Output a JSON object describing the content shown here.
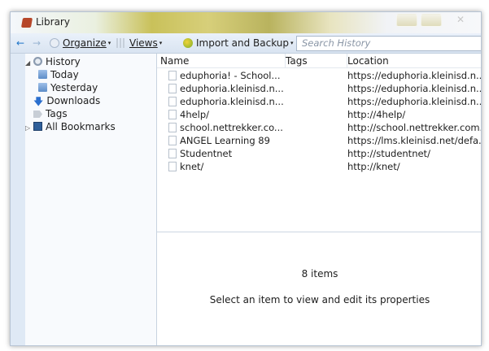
{
  "window": {
    "title": "Library",
    "close_glyph": "✕"
  },
  "toolbar": {
    "back_glyph": "←",
    "forward_glyph": "→",
    "organize_label": "Organize",
    "views_label": "Views",
    "import_label": "Import and Backup",
    "search_placeholder": "Search History"
  },
  "sidebar": {
    "items": [
      {
        "label": "History",
        "icon": "clock-icon"
      },
      {
        "label": "Today",
        "icon": "folder-icon"
      },
      {
        "label": "Yesterday",
        "icon": "folder-icon"
      },
      {
        "label": "Downloads",
        "icon": "download-arrow-icon"
      },
      {
        "label": "Tags",
        "icon": "tag-icon"
      },
      {
        "label": "All Bookmarks",
        "icon": "bookmarks-icon"
      }
    ]
  },
  "table": {
    "columns": [
      "Name",
      "Tags",
      "Location"
    ],
    "rows": [
      {
        "name": "eduphoria! - School...",
        "tags": "",
        "location": "https://eduphoria.kleinisd.n..."
      },
      {
        "name": "eduphoria.kleinisd.n...",
        "tags": "",
        "location": "https://eduphoria.kleinisd.n..."
      },
      {
        "name": "eduphoria.kleinisd.n...",
        "tags": "",
        "location": "https://eduphoria.kleinisd.n..."
      },
      {
        "name": "4help/",
        "tags": "",
        "location": "http://4help/"
      },
      {
        "name": "school.nettrekker.co...",
        "tags": "",
        "location": "http://school.nettrekker.com..."
      },
      {
        "name": "ANGEL Learning 89",
        "tags": "",
        "location": "https://lms.kleinisd.net/defa..."
      },
      {
        "name": "Studentnet",
        "tags": "",
        "location": "http://studentnet/"
      },
      {
        "name": "knet/",
        "tags": "",
        "location": "http://knet/"
      }
    ]
  },
  "details": {
    "count_text": "8 items",
    "hint_text": "Select an item to view and edit its properties"
  },
  "colors": {
    "window_bg": "#dfe9f5",
    "link_blue": "#1e74c8"
  }
}
